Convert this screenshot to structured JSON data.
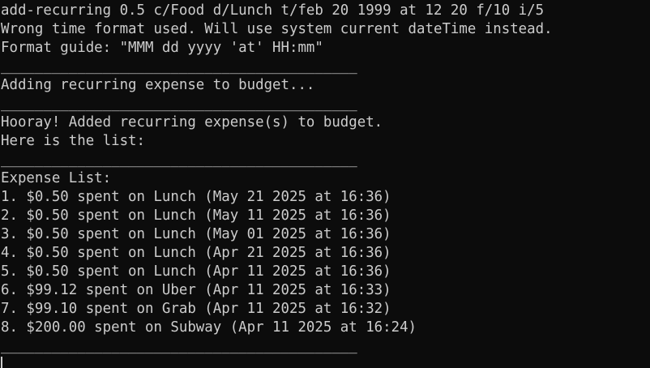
{
  "terminal": {
    "lines": [
      "add-recurring 0.5 c/Food d/Lunch t/feb 20 1999 at 12 20 f/10 i/5",
      "Wrong time format used. Will use system current dateTime instead.",
      "Format guide: \"MMM dd yyyy 'at' HH:mm\"",
      "__________________________________________",
      "Adding recurring expense to budget...",
      "__________________________________________",
      "Hooray! Added recurring expense(s) to budget.",
      "Here is the list:",
      "__________________________________________",
      "Expense List:",
      "1. $0.50 spent on Lunch (May 21 2025 at 16:36)",
      "2. $0.50 spent on Lunch (May 11 2025 at 16:36)",
      "3. $0.50 spent on Lunch (May 01 2025 at 16:36)",
      "4. $0.50 spent on Lunch (Apr 21 2025 at 16:36)",
      "5. $0.50 spent on Lunch (Apr 11 2025 at 16:36)",
      "6. $99.12 spent on Uber (Apr 11 2025 at 16:33)",
      "7. $99.10 spent on Grab (Apr 11 2025 at 16:32)",
      "8. $200.00 spent on Subway (Apr 11 2025 at 16:24)",
      "__________________________________________"
    ]
  },
  "colors": {
    "background": "#0c0c0c",
    "text": "#cccccc"
  }
}
